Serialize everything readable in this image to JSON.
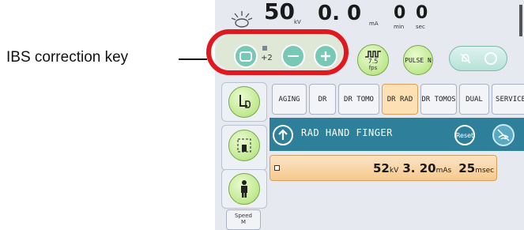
{
  "callout": {
    "label": "IBS correction key"
  },
  "readouts": {
    "kv": {
      "value": "50",
      "unit": "kV"
    },
    "ma": {
      "value": "0. 0",
      "unit": "mA"
    },
    "min": {
      "value": "0",
      "unit": "min"
    },
    "sec": {
      "value": "0",
      "unit": "sec"
    }
  },
  "ibs": {
    "step_value": "+2"
  },
  "controls": {
    "fps_value": "7.5",
    "fps_unit": "fps",
    "pulse_label": "PULSE N"
  },
  "tabs": [
    "AGING",
    "DR",
    "DR TOMO",
    "DR RAD",
    "DR TOMOS",
    "DUAL",
    "SERVICE"
  ],
  "active_tab": "DR RAD",
  "protocol": {
    "title": "RAD HAND FINGER",
    "reset_label": "Reset"
  },
  "exposure": {
    "kv_value": "52",
    "kv_unit": "kV",
    "mas_value": "3. 20",
    "mas_unit": "mAs",
    "time_value": "25",
    "time_unit": "msec"
  },
  "left_panel": {
    "speed_label": "Speed",
    "speed_value": "M"
  },
  "colors": {
    "accent_red": "#e0191f",
    "header_teal": "#2e7f99",
    "active_tab": "#fde0b4"
  }
}
